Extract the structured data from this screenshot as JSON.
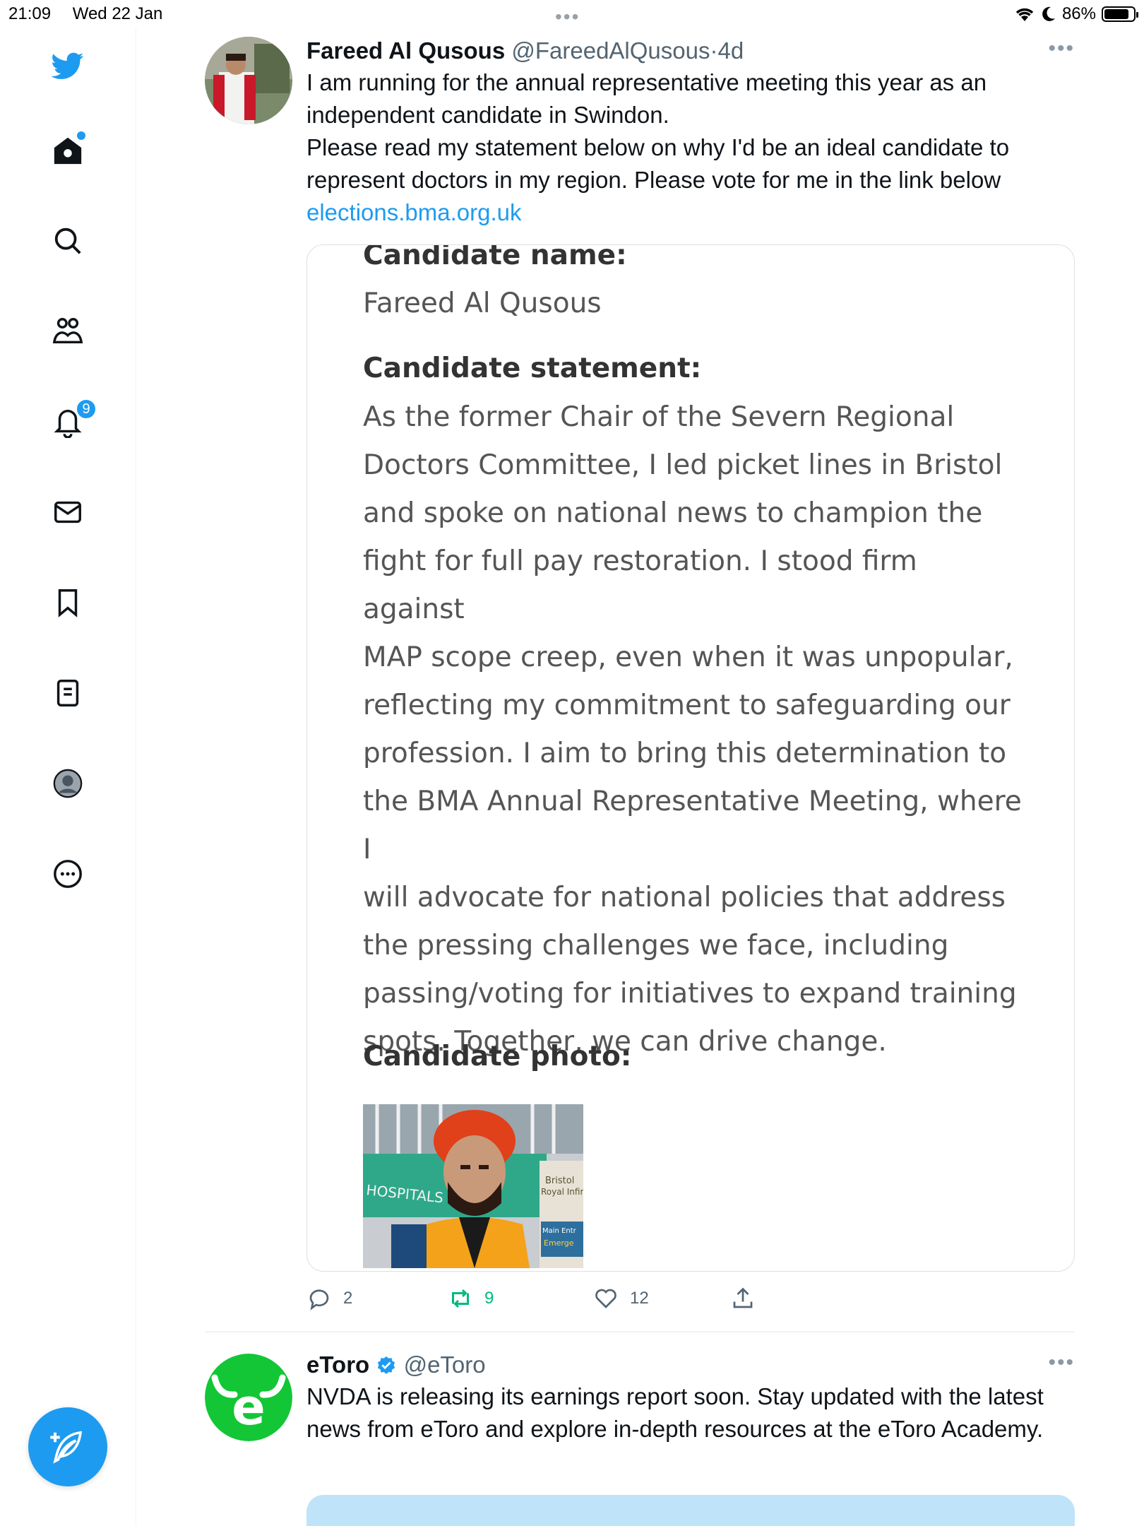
{
  "status_bar": {
    "time": "21:09",
    "date": "Wed 22 Jan",
    "battery_percent_text": "86%",
    "battery_level": 0.86
  },
  "sidebar": {
    "items": [
      {
        "name": "twitter-logo",
        "icon": "bird-icon"
      },
      {
        "name": "home",
        "icon": "home-icon"
      },
      {
        "name": "explore",
        "icon": "search-icon"
      },
      {
        "name": "communities",
        "icon": "communities-icon"
      },
      {
        "name": "notifications",
        "icon": "bell-icon",
        "badge": "9"
      },
      {
        "name": "messages",
        "icon": "envelope-icon"
      },
      {
        "name": "bookmarks",
        "icon": "bookmark-icon"
      },
      {
        "name": "lists",
        "icon": "list-icon"
      },
      {
        "name": "profile",
        "icon": "profile-avatar-icon"
      },
      {
        "name": "more",
        "icon": "more-circle-icon"
      }
    ],
    "compose_icon": "compose-feather-icon",
    "accent_color": "#1d9bf0"
  },
  "tweets": [
    {
      "author_name": "Fareed Al Qusous",
      "handle": "@FareedAlQusous",
      "separator": "·",
      "time": "4d",
      "text_line1": "I am running for the annual representative meeting this year as an independent candidate in Swindon.",
      "text_line2": "Please read my statement below on why I'd be an ideal candidate to represent doctors in my region. Please vote for me in the link below",
      "link": "elections.bma.org.uk",
      "card": {
        "name_label": "Candidate name:",
        "name_value": "Fareed Al Qusous",
        "statement_label": "Candidate statement:",
        "statement_lines": [
          "As the former Chair of the Severn Regional",
          "Doctors Committee, I led picket lines in Bristol",
          "and spoke on national news to champion the",
          "fight for full pay restoration. I stood firm against",
          "MAP scope creep, even when it was unpopular,",
          "reflecting my commitment to safeguarding our",
          "profession. I aim to bring this determination to",
          "the BMA Annual Representative Meeting, where I",
          "will advocate for national policies that address",
          "the pressing challenges we face, including",
          "passing/voting for initiatives to expand training",
          "spots. Together, we can drive change."
        ],
        "photo_label": "Candidate photo:",
        "photo_sign_text": "HOSPITALS BR",
        "photo_sign_bristol": "Bristol",
        "photo_sign_royal": "Royal Infir",
        "photo_sign_main": "Main Entr",
        "photo_sign_emerg": "Emerge"
      },
      "replies": "2",
      "retweets": "9",
      "likes": "12"
    },
    {
      "author_name": "eToro",
      "handle": "@eToro",
      "verified": true,
      "text": "NVDA is releasing its earnings report soon. Stay updated with the latest news from eToro and explore in-depth resources at the eToro Academy.",
      "avatar_letter": "e",
      "brand_color": "#13c636"
    }
  ]
}
